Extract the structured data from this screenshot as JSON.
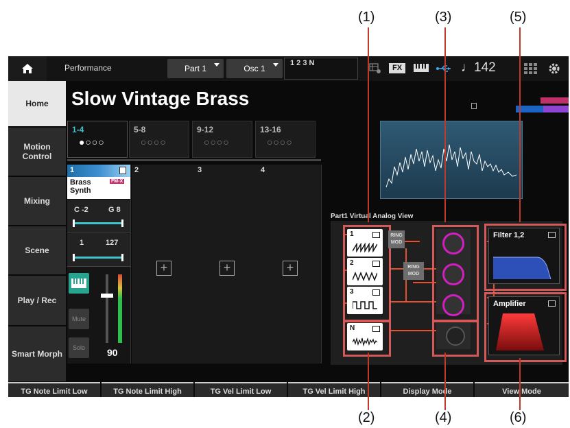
{
  "callouts": [
    "(1)",
    "(2)",
    "(3)",
    "(4)",
    "(5)",
    "(6)"
  ],
  "topbar": {
    "title": "Performance",
    "part_tab": "Part 1",
    "osc_tab": "Osc 1",
    "osc_numbers": "1 2 3 N",
    "fx_label": "FX",
    "tempo": "♩142"
  },
  "performance_name": "Slow Vintage Brass",
  "sidebar": {
    "items": [
      {
        "label": "Home"
      },
      {
        "label": "Motion Control"
      },
      {
        "label": "Mixing"
      },
      {
        "label": "Scene"
      },
      {
        "label": "Play / Rec"
      },
      {
        "label": "Smart Morph"
      }
    ]
  },
  "part_groups": [
    {
      "label": "1-4",
      "dots": "●○○○"
    },
    {
      "label": "5-8",
      "dots": "○○○○"
    },
    {
      "label": "9-12",
      "dots": "○○○○"
    },
    {
      "label": "13-16",
      "dots": "○○○○"
    }
  ],
  "part1": {
    "number": "1",
    "name": "Brass Synth",
    "note_low": "C -2",
    "note_high": "G 8",
    "vel_low": "1",
    "vel_high": "127",
    "mute_label": "Mute",
    "solo_label": "Solo",
    "volume": "90",
    "engine_badge": "FM-X"
  },
  "slots": [
    "2",
    "3",
    "4"
  ],
  "virtual_analog": {
    "title": "Part1 Virtual Analog View",
    "osc_labels": [
      "1",
      "2",
      "3",
      "N"
    ],
    "ring_mod_1": "RING MOD",
    "ring_mod_2": "RING MOD",
    "filter_label": "Filter 1,2",
    "amplifier_label": "Amplifier"
  },
  "softkeys": [
    "TG Note Limit Low",
    "TG Note Limit High",
    "TG Vel Limit Low",
    "TG Vel Limit High",
    "Display Mode",
    "View Mode"
  ]
}
